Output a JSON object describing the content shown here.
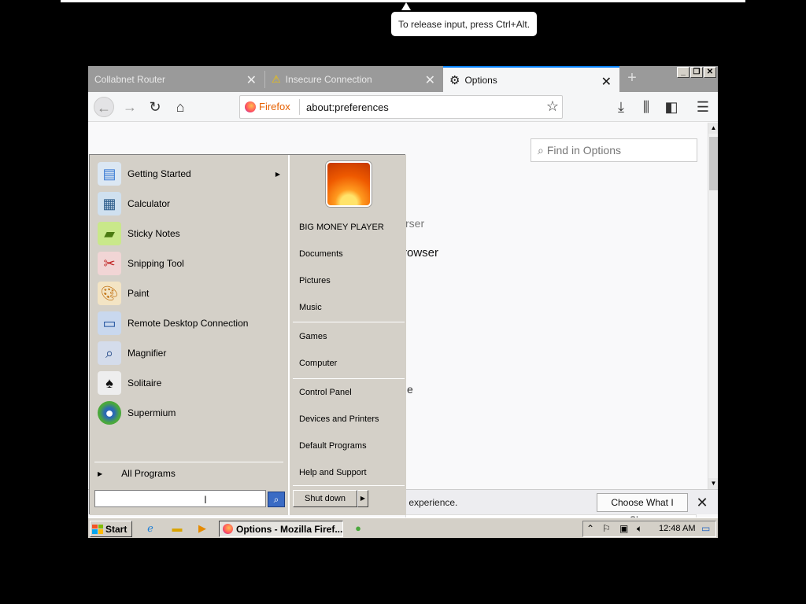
{
  "console": {
    "release_hint": "To release input, press Ctrl+Alt."
  },
  "browser": {
    "tabs": [
      {
        "title": "Collabnet Router",
        "active": false,
        "icon": "none"
      },
      {
        "title": "Insecure Connection",
        "active": false,
        "icon": "warning-icon"
      },
      {
        "title": "Options",
        "active": true,
        "icon": "gear-icon"
      }
    ],
    "identity_label": "Firefox",
    "url": "about:preferences",
    "find_placeholder": "Find in Options",
    "peek_text": [
      "rser",
      "rowser",
      "e"
    ],
    "notification": {
      "text": "r experience.",
      "button": "Choose What I Share"
    },
    "colors": {
      "accent": "#0a84ff",
      "firefox_orange": "#e66000"
    }
  },
  "start_menu": {
    "programs": [
      {
        "label": "Getting Started",
        "icon": "getting-started-icon",
        "submenu": true
      },
      {
        "label": "Calculator",
        "icon": "calculator-icon",
        "submenu": false
      },
      {
        "label": "Sticky Notes",
        "icon": "sticky-notes-icon",
        "submenu": false
      },
      {
        "label": "Snipping Tool",
        "icon": "scissors-icon",
        "submenu": false
      },
      {
        "label": "Paint",
        "icon": "paint-palette-icon",
        "submenu": false
      },
      {
        "label": "Remote Desktop Connection",
        "icon": "remote-desktop-icon",
        "submenu": false
      },
      {
        "label": "Magnifier",
        "icon": "magnifier-icon",
        "submenu": false
      },
      {
        "label": "Solitaire",
        "icon": "cards-icon",
        "submenu": false
      },
      {
        "label": "Supermium",
        "icon": "supermium-icon",
        "submenu": false
      }
    ],
    "all_programs": "All Programs",
    "user_name": "BIG MONEY PLAYER",
    "places": [
      "Documents",
      "Pictures",
      "Music",
      "Games",
      "Computer",
      "Control Panel",
      "Devices and Printers",
      "Default Programs",
      "Help and Support"
    ],
    "shutdown_label": "Shut down"
  },
  "taskbar": {
    "start_label": "Start",
    "active_task": "Options - Mozilla Firef...",
    "clock": "12:48 AM"
  }
}
